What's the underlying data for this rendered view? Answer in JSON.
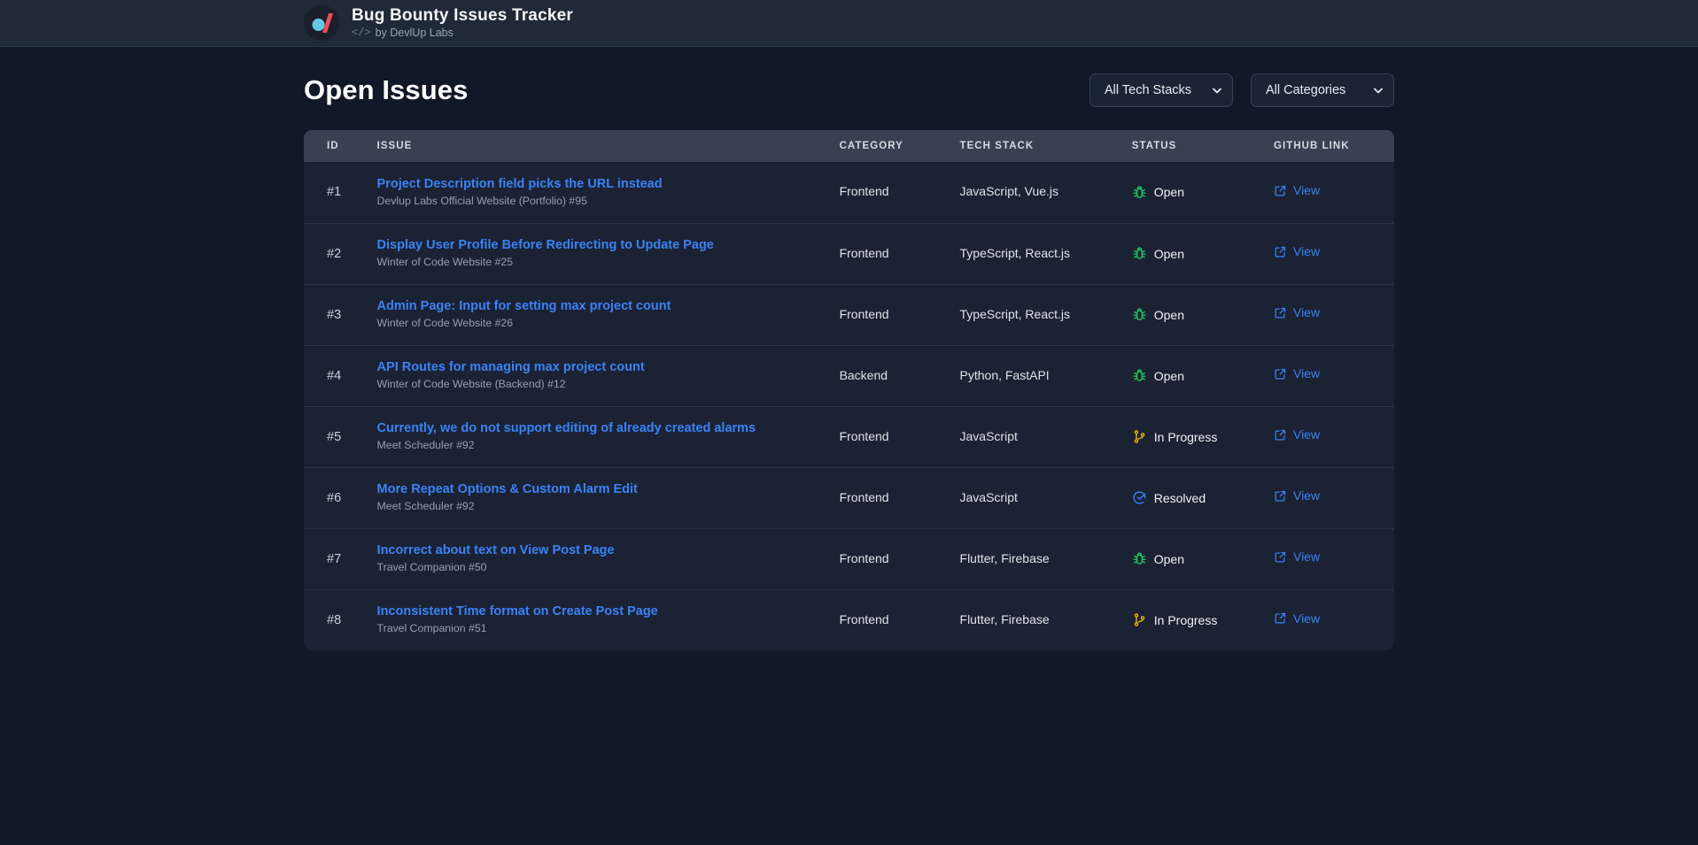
{
  "navbar": {
    "logo_icon": "devlup-labs-logo-icon",
    "title": "Bug Bounty Issues Tracker",
    "code_glyph": "</>",
    "subtitle": "by DevlUp Labs"
  },
  "page": {
    "title": "Open Issues"
  },
  "filters": [
    {
      "name": "tech-stack-filter",
      "value": "All Tech Stacks",
      "caret_icon": "chevron-down-icon"
    },
    {
      "name": "category-filter",
      "value": "All Categories",
      "caret_icon": "chevron-down-icon"
    }
  ],
  "table": {
    "columns": [
      "ID",
      "ISSUE",
      "CATEGORY",
      "TECH STACK",
      "STATUS",
      "GITHUB LINK"
    ],
    "link_label": "View",
    "link_icon": "external-link-icon",
    "status_icons": {
      "Open": "bug-icon",
      "In Progress": "git-branch-icon",
      "Resolved": "check-circle-icon"
    },
    "status_colors": {
      "Open": "#22c55e",
      "In Progress": "#eab308",
      "Resolved": "#3b82f6"
    },
    "rows": [
      {
        "id": "#1",
        "title": "Project Description field picks the URL instead",
        "repo": "Devlup Labs Official Website (Portfolio) #95",
        "category": "Frontend",
        "tech": "JavaScript, Vue.js",
        "status": "Open"
      },
      {
        "id": "#2",
        "title": "Display User Profile Before Redirecting to Update Page",
        "repo": "Winter of Code Website #25",
        "category": "Frontend",
        "tech": "TypeScript, React.js",
        "status": "Open"
      },
      {
        "id": "#3",
        "title": "Admin Page: Input for setting max project count",
        "repo": "Winter of Code Website #26",
        "category": "Frontend",
        "tech": "TypeScript, React.js",
        "status": "Open"
      },
      {
        "id": "#4",
        "title": "API Routes for managing max project count",
        "repo": "Winter of Code Website (Backend) #12",
        "category": "Backend",
        "tech": "Python, FastAPI",
        "status": "Open"
      },
      {
        "id": "#5",
        "title": "Currently, we do not support editing of already created alarms",
        "repo": "Meet Scheduler #92",
        "category": "Frontend",
        "tech": "JavaScript",
        "status": "In Progress"
      },
      {
        "id": "#6",
        "title": "More Repeat Options & Custom Alarm Edit",
        "repo": "Meet Scheduler #92",
        "category": "Frontend",
        "tech": "JavaScript",
        "status": "Resolved"
      },
      {
        "id": "#7",
        "title": "Incorrect about text on View Post Page",
        "repo": "Travel Companion #50",
        "category": "Frontend",
        "tech": "Flutter, Firebase",
        "status": "Open"
      },
      {
        "id": "#8",
        "title": "Inconsistent Time format on Create Post Page",
        "repo": "Travel Companion #51",
        "category": "Frontend",
        "tech": "Flutter, Firebase",
        "status": "In Progress"
      }
    ]
  },
  "theme": {
    "page_bg": "#111827",
    "navbar_bg": "#1f2937",
    "card_bg": "#1b2233",
    "thead_bg": "#374151",
    "link_blue": "#3b82f6"
  }
}
